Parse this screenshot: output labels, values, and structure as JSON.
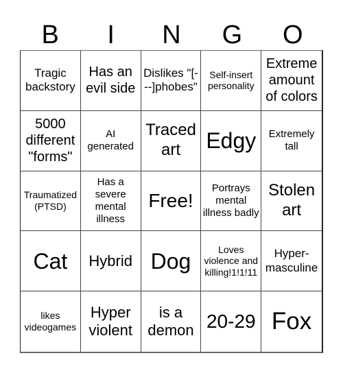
{
  "header": [
    "B",
    "I",
    "N",
    "G",
    "O"
  ],
  "cells": [
    "Tragic backstory",
    "Has an evil side",
    "Dislikes \"[---]phobes\"",
    "Self-insert personality",
    "Extreme amount of colors",
    "5000 different \"forms\"",
    "AI generated",
    "Traced art",
    "Edgy",
    "Extremely tall",
    "Traumatized (PTSD)",
    "Has a severe mental illness",
    "Free!",
    "Portrays mental illness badly",
    "Stolen art",
    "Cat",
    "Hybrid",
    "Dog",
    "Loves violence and killing!1!1!11",
    "Hyper-masculine",
    "likes videogames",
    "Hyper violent",
    "is a demon",
    "20-29",
    "Fox"
  ]
}
